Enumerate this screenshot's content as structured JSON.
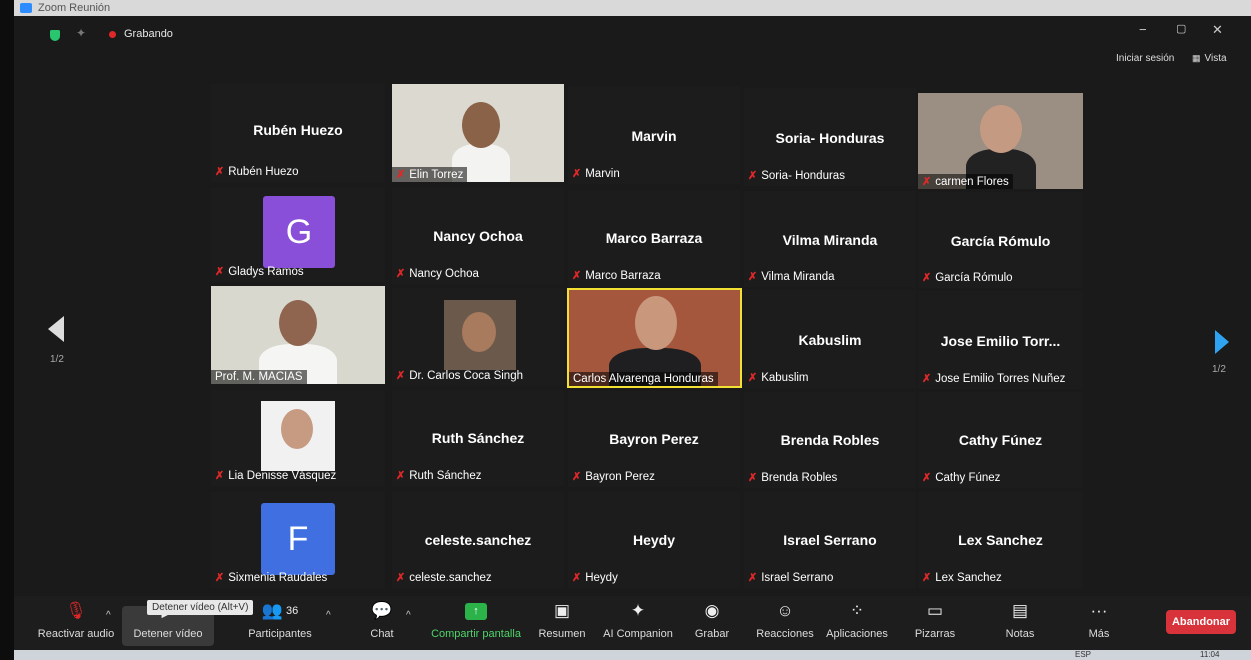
{
  "window": {
    "title": "Zoom Reunión",
    "minimize": "−",
    "restore": "▢",
    "close": "✕"
  },
  "status": {
    "recording": "Grabando",
    "sign_in": "Iniciar sesión",
    "view": "Vista"
  },
  "page": {
    "left_indicator": "1/2",
    "right_indicator": "1/2"
  },
  "participants": [
    {
      "id": "t1",
      "display": "Rubén Huezo",
      "label": "Rubén Huezo",
      "type": "name",
      "muted": true
    },
    {
      "id": "t2",
      "display": "",
      "label": "Elin Torrez",
      "type": "video",
      "muted": true
    },
    {
      "id": "t3",
      "display": "Marvin",
      "label": "Marvin",
      "type": "name",
      "muted": true
    },
    {
      "id": "t4",
      "display": "Soria- Honduras",
      "label": "Soria- Honduras",
      "type": "name",
      "muted": true
    },
    {
      "id": "t5",
      "display": "",
      "label": "carmen Flores",
      "type": "video",
      "muted": true
    },
    {
      "id": "t6",
      "display": "G",
      "label": "Gladys Ramos",
      "type": "avatar",
      "muted": true
    },
    {
      "id": "t7",
      "display": "Nancy Ochoa",
      "label": "Nancy Ochoa",
      "type": "name",
      "muted": true
    },
    {
      "id": "t8",
      "display": "Marco Barraza",
      "label": "Marco Barraza",
      "type": "name",
      "muted": true
    },
    {
      "id": "t9",
      "display": "Vilma Miranda",
      "label": "Vilma Miranda",
      "type": "name",
      "muted": true
    },
    {
      "id": "t10",
      "display": "García Rómulo",
      "label": "García Rómulo",
      "type": "name",
      "muted": true
    },
    {
      "id": "t11",
      "display": "",
      "label": "Prof. M. MACIAS",
      "type": "video",
      "muted": false
    },
    {
      "id": "t12",
      "display": "",
      "label": "Dr. Carlos Coca Singh",
      "type": "photo",
      "muted": true
    },
    {
      "id": "t13",
      "display": "",
      "label": "Carlos Alvarenga Honduras",
      "type": "video",
      "muted": false
    },
    {
      "id": "t14",
      "display": "Kabuslim",
      "label": "Kabuslim",
      "type": "name",
      "muted": true
    },
    {
      "id": "t15",
      "display": "Jose Emilio Torr...",
      "label": "Jose Emilio Torres Nuñez",
      "type": "name",
      "muted": true
    },
    {
      "id": "t16",
      "display": "",
      "label": "Lia Denisse Vásquez",
      "type": "photo",
      "muted": true
    },
    {
      "id": "t17",
      "display": "Ruth Sánchez",
      "label": "Ruth Sánchez",
      "type": "name",
      "muted": true
    },
    {
      "id": "t18",
      "display": "Bayron Perez",
      "label": "Bayron Perez",
      "type": "name",
      "muted": true
    },
    {
      "id": "t19",
      "display": "Brenda Robles",
      "label": "Brenda Robles",
      "type": "name",
      "muted": true
    },
    {
      "id": "t20",
      "display": "Cathy Fúnez",
      "label": "Cathy Fúnez",
      "type": "name",
      "muted": true
    },
    {
      "id": "t21",
      "display": "F",
      "label": "Sixmenia Raudales",
      "type": "avatar",
      "muted": true
    },
    {
      "id": "t22",
      "display": "celeste.sanchez",
      "label": "celeste.sanchez",
      "type": "name",
      "muted": true
    },
    {
      "id": "t23",
      "display": "Heydy",
      "label": "Heydy",
      "type": "name",
      "muted": true
    },
    {
      "id": "t24",
      "display": "Israel Serrano",
      "label": "Israel Serrano",
      "type": "name",
      "muted": true
    },
    {
      "id": "t25",
      "display": "Lex Sanchez",
      "label": "Lex Sanchez",
      "type": "name",
      "muted": true
    }
  ],
  "toolbar": {
    "unmute": "Reactivar audio",
    "stop_video": "Detener vídeo",
    "stop_video_tooltip": "Detener vídeo (Alt+V)",
    "participants": "Participantes",
    "participants_count": "36",
    "chat": "Chat",
    "share": "Compartir pantalla",
    "summary": "Resumen",
    "ai": "AI Companion",
    "record": "Grabar",
    "reactions": "Reacciones",
    "apps": "Aplicaciones",
    "whiteboards": "Pizarras",
    "notes": "Notas",
    "more": "Más",
    "leave": "Abandonar"
  },
  "taskbar": {
    "lang": "ESP",
    "time": "11:04"
  },
  "colors": {
    "accent_blue": "#2ea3f2",
    "leave_red": "#d8333b",
    "active_border": "#f2e033",
    "share_green": "#2bb34a",
    "mute_red": "#e02828",
    "avatar_g": "#8a4fd8",
    "avatar_f": "#3f6fe0"
  }
}
